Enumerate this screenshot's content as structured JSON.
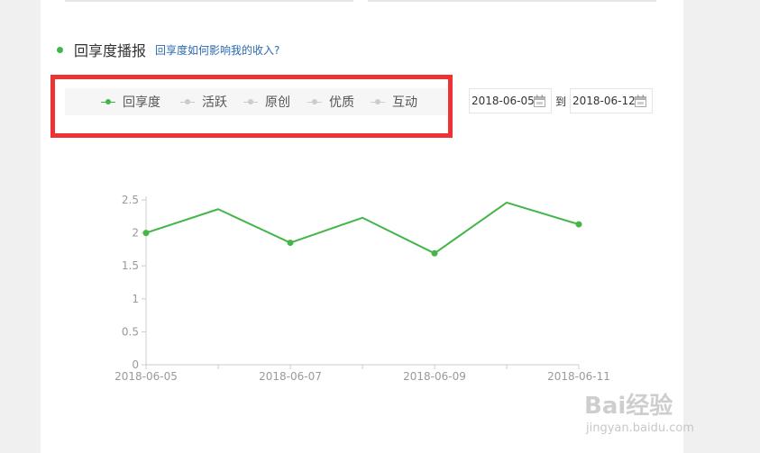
{
  "section": {
    "title": "回享度播报",
    "help_link": "回享度如何影响我的收入?"
  },
  "legend": {
    "items": [
      {
        "label": "回享度",
        "active": true,
        "color": "#44b549"
      },
      {
        "label": "活跃",
        "active": false,
        "color": "#cccccc"
      },
      {
        "label": "原创",
        "active": false,
        "color": "#cccccc"
      },
      {
        "label": "优质",
        "active": false,
        "color": "#cccccc"
      },
      {
        "label": "互动",
        "active": false,
        "color": "#cccccc"
      }
    ]
  },
  "date_range": {
    "start": "2018-06-05",
    "separator": "到",
    "end": "2018-06-12"
  },
  "colors": {
    "accent": "#44b549",
    "highlight_border": "#ee3133",
    "axis": "#cccccc",
    "tick_text": "#9a9a9a"
  },
  "chart_data": {
    "type": "line",
    "x": [
      "2018-06-05",
      "2018-06-06",
      "2018-06-07",
      "2018-06-08",
      "2018-06-09",
      "2018-06-10",
      "2018-06-11"
    ],
    "x_tick_labels": [
      "2018-06-05",
      "2018-06-07",
      "2018-06-09",
      "2018-06-11"
    ],
    "y_tick_labels": [
      "0",
      "0.5",
      "1",
      "1.5",
      "2",
      "2.5"
    ],
    "ylim": [
      0,
      2.5
    ],
    "series": [
      {
        "values": [
          2.0,
          2.36,
          1.85,
          2.23,
          1.69,
          2.46,
          2.13
        ],
        "markers": [
          true,
          false,
          true,
          false,
          true,
          false,
          true
        ],
        "color": "#44b549"
      }
    ],
    "grid": false
  },
  "watermark": {
    "logo": "Bai经验",
    "url": "jingyan.baidu.com"
  }
}
